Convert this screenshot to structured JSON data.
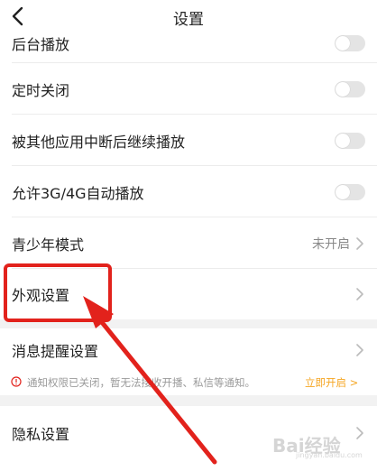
{
  "header": {
    "title": "设置",
    "back_icon": "chevron-left-icon"
  },
  "settings": {
    "partial_row_label": "后台播放",
    "timer_off_label": "定时关闭",
    "resume_playback_label": "被其他应用中断后继续播放",
    "autoplay_label": "允许3G/4G自动播放",
    "youth_mode_label": "青少年模式",
    "youth_mode_value": "未开启",
    "appearance_label": "外观设置",
    "message_reminder_label": "消息提醒设置",
    "privacy_label": "隐私设置"
  },
  "toggles": {
    "background_play": false,
    "timer_off": false,
    "resume_playback": false,
    "autoplay": false
  },
  "notice": {
    "message": "通知权限已关闭，暂无法接收开播、私信等通知。",
    "action": "立即开启 >"
  },
  "watermark": {
    "text": "Bai经验",
    "sub": "jingyan.baidu.com"
  },
  "colors": {
    "highlight": "#e2221c",
    "notice_action": "#f5a623",
    "toggle_off": "#e4e4e4",
    "section_gap": "#f2f2f2"
  }
}
